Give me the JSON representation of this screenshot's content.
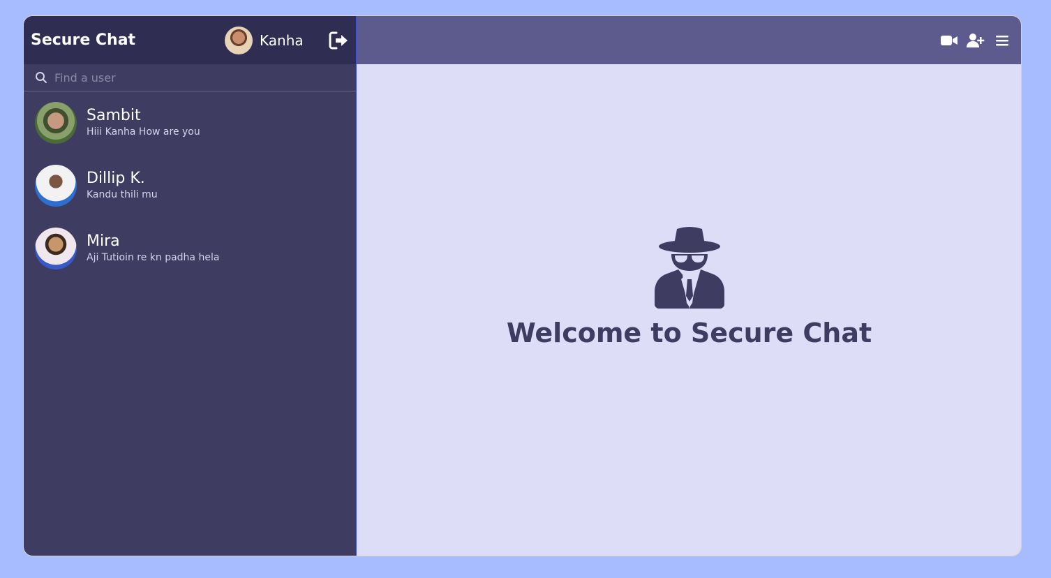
{
  "app": {
    "title": "Secure Chat"
  },
  "current_user": {
    "name": "Kanha"
  },
  "search": {
    "placeholder": "Find a user"
  },
  "chats": [
    {
      "name": "Sambit",
      "last_message": "Hiii Kanha How are you"
    },
    {
      "name": "Dillip K.",
      "last_message": "Kandu thili mu"
    },
    {
      "name": "Mira",
      "last_message": "Aji Tutioin re kn padha hela"
    }
  ],
  "main": {
    "welcome": "Welcome to Secure Chat"
  },
  "icons": {
    "logout": "logout-icon",
    "video": "video-camera-icon",
    "add_user": "add-user-icon",
    "menu": "menu-icon",
    "search": "search-icon",
    "spy": "user-secret-icon"
  },
  "colors": {
    "background": "#a7bcff",
    "sidebar": "#3e3c61",
    "sidebar_header": "#2f2d52",
    "main_header": "#5d5b8d",
    "main_bg": "#ddddf7"
  }
}
